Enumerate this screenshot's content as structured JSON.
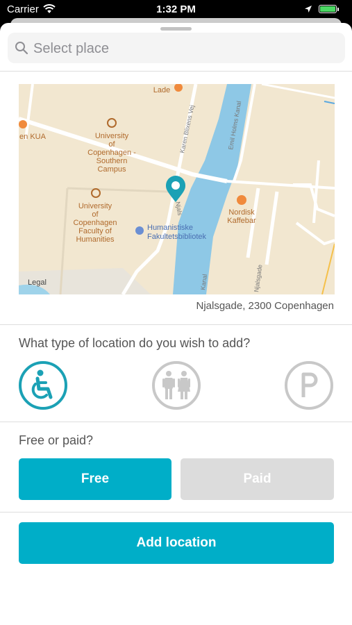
{
  "status_bar": {
    "carrier": "Carrier",
    "time": "1:32 PM"
  },
  "search": {
    "placeholder": "Select place"
  },
  "map": {
    "legal_label": "Legal",
    "labels": {
      "lade": "Lade",
      "kua": "en KUA",
      "uni_south": [
        "University",
        "of",
        "Copenhagen -",
        "Southern",
        "Campus"
      ],
      "uni_hum": [
        "University",
        "of",
        "Copenhagen",
        "Faculty of",
        "Humanities"
      ],
      "library": [
        "Humanistiske",
        "Fakultetsbibliotek"
      ],
      "nordisk": [
        "Nordisk",
        "Kaffebar"
      ],
      "street_karen": "Karen Blixens Vej",
      "street_emil": "Emil Holms Kanal",
      "street_njalsgade": "Njalsgade",
      "street_njals_short": "Njals",
      "street_kanal": "Kanal"
    }
  },
  "address": "Njalsgade, 2300 Copenhagen",
  "location_type": {
    "question": "What type of location do you wish to add?",
    "options": [
      {
        "name": "wheelchair",
        "selected": true
      },
      {
        "name": "toilet",
        "selected": false
      },
      {
        "name": "parking",
        "selected": false
      }
    ]
  },
  "payment": {
    "question": "Free or paid?",
    "free_label": "Free",
    "paid_label": "Paid",
    "selected": "Free"
  },
  "submit_label": "Add location",
  "colors": {
    "accent": "#00aec8",
    "inactive": "#dcdcdc",
    "icon_inactive": "#c8c8c8"
  }
}
